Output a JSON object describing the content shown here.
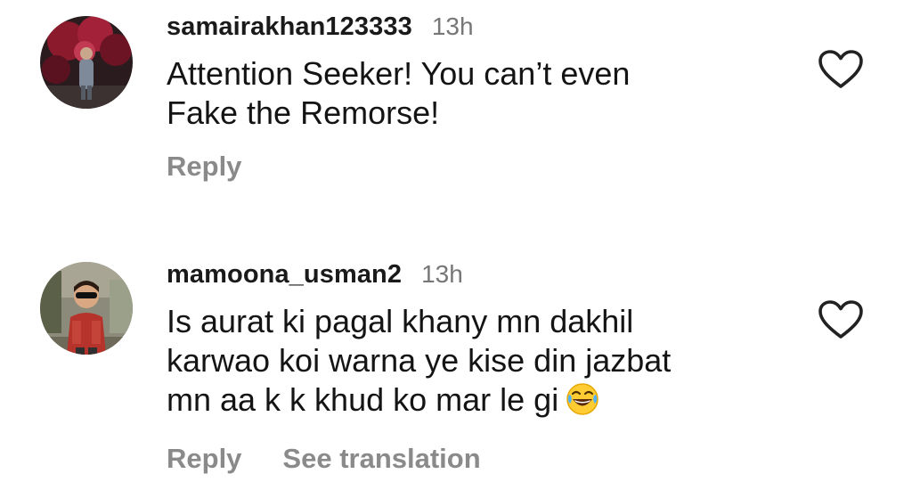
{
  "comments": [
    {
      "username": "samairakhan123333",
      "time": "13h",
      "lines": [
        "Attention Seeker! You can’t even",
        "Fake the Remorse!"
      ],
      "actions": {
        "reply": "Reply"
      },
      "avatar_icon": "profile-photo",
      "like_icon": "heart-outline-icon"
    },
    {
      "username": "mamoona_usman2",
      "time": "13h",
      "lines": [
        "Is aurat ki pagal khany mn dakhil",
        "karwao koi warna ye kise din jazbat",
        "mn aa k k khud ko mar le gi"
      ],
      "emoji": "face-with-tears-of-joy",
      "actions": {
        "reply": "Reply",
        "translate": "See translation"
      },
      "avatar_icon": "profile-photo",
      "like_icon": "heart-outline-icon"
    }
  ],
  "colors": {
    "username": "#1a1a1a",
    "text": "#141414",
    "time": "#777777",
    "action": "#8a8a8a",
    "heart_stroke": "#222222"
  }
}
